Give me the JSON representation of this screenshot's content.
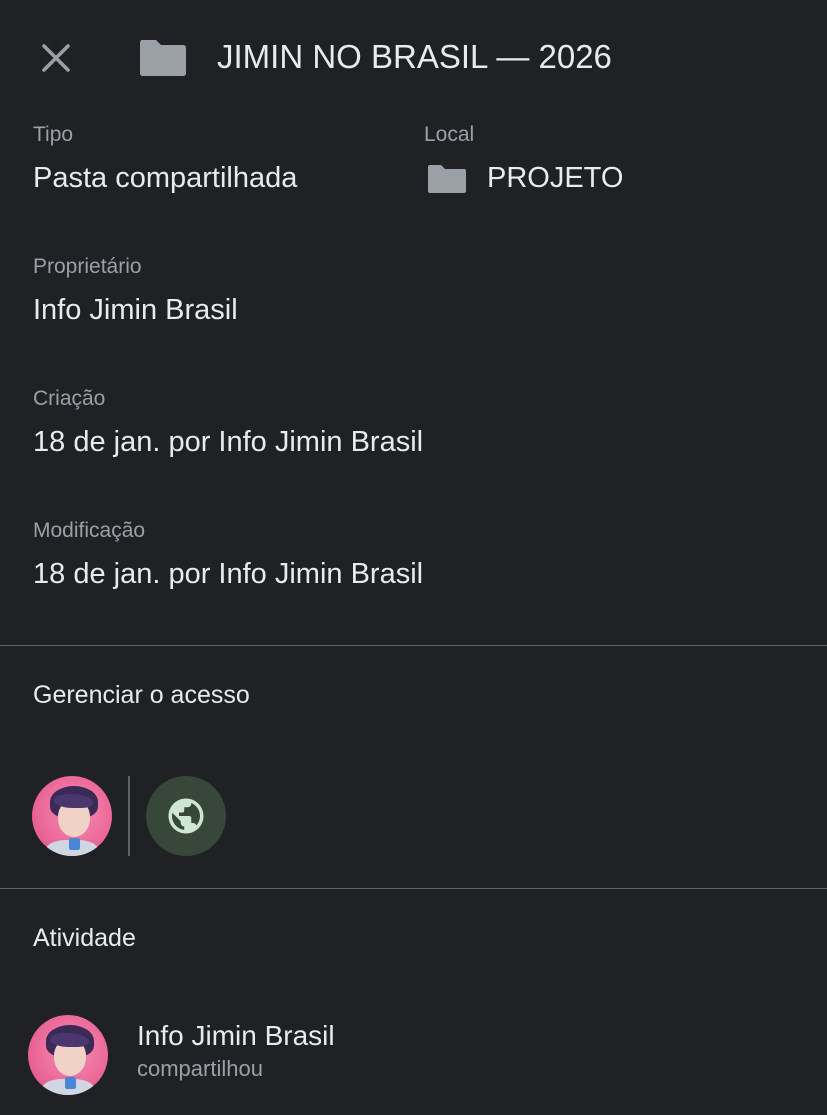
{
  "header": {
    "title": "JIMIN NO BRASIL — 2026",
    "close_icon": "close-icon",
    "folder_icon": "folder-icon"
  },
  "details": {
    "type_label": "Tipo",
    "type_value": "Pasta compartilhada",
    "location_label": "Local",
    "location_value": "PROJETO",
    "owner_label": "Proprietário",
    "owner_value": "Info Jimin Brasil",
    "created_label": "Criação",
    "created_value": "18 de jan. por Info Jimin Brasil",
    "modified_label": "Modificação",
    "modified_value": "18 de jan. por Info Jimin Brasil"
  },
  "access": {
    "title": "Gerenciar o acesso",
    "avatar_icon": "user-avatar",
    "globe_icon": "globe-icon"
  },
  "activity": {
    "title": "Atividade",
    "items": [
      {
        "name": "Info Jimin Brasil",
        "action": "compartilhou"
      }
    ]
  },
  "colors": {
    "background": "#202124",
    "text_primary": "#e8eaed",
    "text_secondary": "#9aa0a6",
    "divider": "#5f6368",
    "globe_bg": "#37483b",
    "globe_fg": "#cfe6d3",
    "avatar_bg": "#ec6a9a"
  }
}
